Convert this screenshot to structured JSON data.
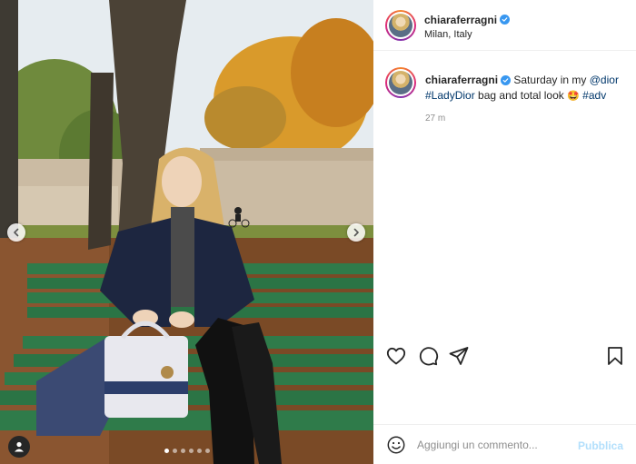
{
  "post": {
    "username": "chiaraferragni",
    "verified": true,
    "location": "Milan, Italy",
    "caption": {
      "username": "chiaraferragni",
      "text_1": " Saturday in my ",
      "mention": "@dior",
      "hashtag_1": "#LadyDior",
      "text_2": " bag and total look ",
      "emoji": "🤩",
      "hashtag_2": "#adv"
    },
    "time": "27 m"
  },
  "carousel": {
    "total": 6,
    "active": 0
  },
  "comment": {
    "placeholder": "Aggiungi un commento...",
    "publish_label": "Pubblica"
  },
  "icons": {
    "like": "heart-icon",
    "comment": "comment-icon",
    "share": "paper-plane-icon",
    "save": "bookmark-icon",
    "emoji": "smiley-icon",
    "tag": "user-tag-icon",
    "prev": "chevron-left-icon",
    "next": "chevron-right-icon",
    "verified": "verified-badge-icon"
  },
  "colors": {
    "link": "#00376b",
    "verified": "#3897f0",
    "muted": "#8e8e8e",
    "publish_disabled": "#b2dffc"
  }
}
